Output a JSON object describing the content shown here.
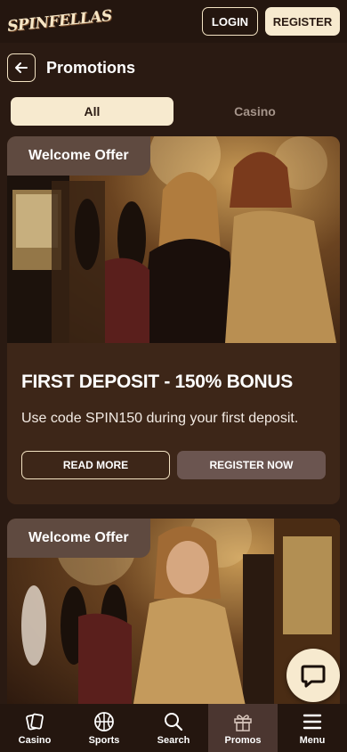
{
  "header": {
    "logo_text": "SPINFELLAS",
    "login_label": "LOGIN",
    "register_label": "REGISTER"
  },
  "page": {
    "title": "Promotions"
  },
  "tabs": [
    {
      "label": "All",
      "active": true
    },
    {
      "label": "Casino",
      "active": false
    }
  ],
  "promotions": [
    {
      "tag": "Welcome Offer",
      "title": "FIRST DEPOSIT - 150% BONUS",
      "description": "Use code SPIN150 during your first deposit.",
      "read_more_label": "READ MORE",
      "register_label": "REGISTER NOW",
      "image": "two-women-at-slot-machine"
    },
    {
      "tag": "Welcome Offer",
      "image": "woman-in-gold-dress-at-slot-machine"
    }
  ],
  "bottom_nav": [
    {
      "label": "Casino",
      "icon": "cards-icon",
      "active": false
    },
    {
      "label": "Sports",
      "icon": "basketball-icon",
      "active": false
    },
    {
      "label": "Search",
      "icon": "search-icon",
      "active": false
    },
    {
      "label": "Promos",
      "icon": "gift-icon",
      "active": true
    },
    {
      "label": "Menu",
      "icon": "menu-icon",
      "active": false
    }
  ],
  "colors": {
    "background": "#2a1a12",
    "header": "#24160f",
    "card": "#3d2618",
    "accent_cream": "#f7eacf",
    "tag_bg": "#5f4a40",
    "secondary_button": "#6b5550"
  }
}
